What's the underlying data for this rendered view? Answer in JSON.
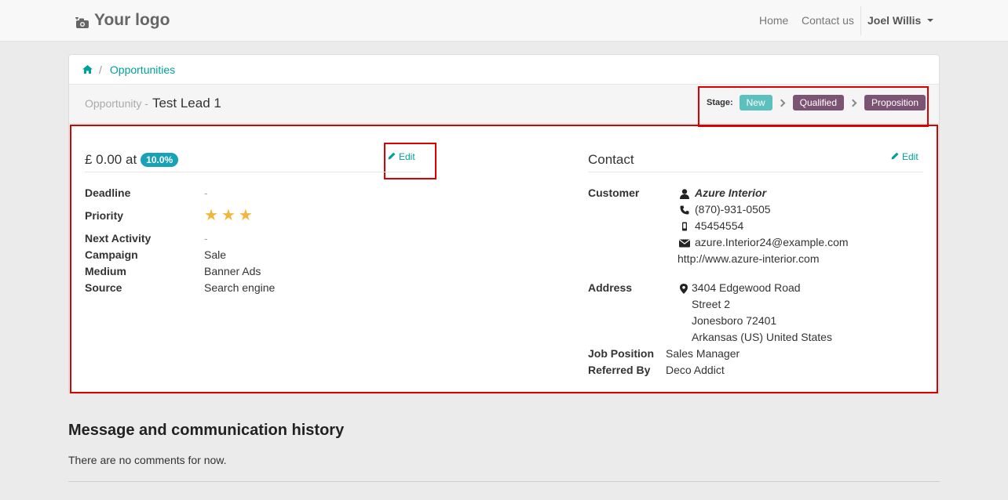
{
  "navbar": {
    "logo_text": "Your logo",
    "links": [
      "Home",
      "Contact us"
    ],
    "user": "Joel Willis"
  },
  "breadcrumb": {
    "separator": "/",
    "current": "Opportunities"
  },
  "opportunity": {
    "label": "Opportunity -",
    "name": "Test Lead 1"
  },
  "stage": {
    "label": "Stage:",
    "steps": [
      {
        "name": "New",
        "color": "#5bc0be"
      },
      {
        "name": "Qualified",
        "color": "#7c5373"
      },
      {
        "name": "Proposition",
        "color": "#7c5373"
      }
    ]
  },
  "deal": {
    "amount": "£ 0.00 at",
    "probability": "10.0%",
    "edit_label": "Edit",
    "fields": {
      "deadline_label": "Deadline",
      "deadline_value": "-",
      "priority_label": "Priority",
      "priority_stars": 3,
      "next_activity_label": "Next Activity",
      "next_activity_value": "-",
      "campaign_label": "Campaign",
      "campaign_value": "Sale",
      "medium_label": "Medium",
      "medium_value": "Banner Ads",
      "source_label": "Source",
      "source_value": "Search engine"
    }
  },
  "contact": {
    "title": "Contact",
    "edit_label": "Edit",
    "customer_label": "Customer",
    "customer_name": "Azure Interior",
    "phone": "(870)-931-0505",
    "mobile": "45454554",
    "email": "azure.Interior24@example.com",
    "website": "http://www.azure-interior.com",
    "address_label": "Address",
    "address_lines": [
      "3404 Edgewood Road",
      "Street 2",
      "Jonesboro 72401",
      "Arkansas (US) United States"
    ],
    "job_label": "Job Position",
    "job_value": "Sales Manager",
    "referred_label": "Referred By",
    "referred_value": "Deco Addict"
  },
  "history": {
    "title": "Message and communication history",
    "empty_text": "There are no comments for now."
  },
  "colors": {
    "accent": "#00a09d",
    "highlight_box": "#dd0000",
    "star": "#f3b63d"
  }
}
